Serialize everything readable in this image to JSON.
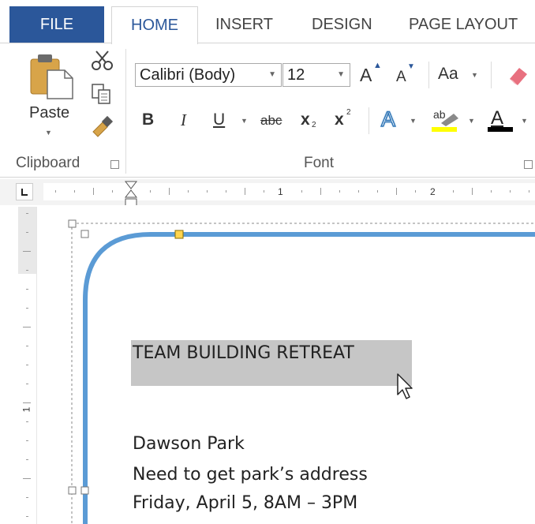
{
  "tabs": {
    "file": "FILE",
    "home": "HOME",
    "insert": "INSERT",
    "design": "DESIGN",
    "page_layout": "PAGE LAYOUT"
  },
  "clipboard": {
    "paste_label": "Paste",
    "group_label": "Clipboard"
  },
  "font": {
    "font_name": "Calibri (Body)",
    "font_size": "12",
    "change_case_label": "Aa",
    "group_label": "Font",
    "bold_label": "B",
    "italic_label": "I",
    "underline_label": "U",
    "strikethrough_label": "abc",
    "subscript_label": "x",
    "subscript_sub": "2",
    "superscript_label": "x",
    "superscript_sup": "2",
    "grow_font_label": "A",
    "shrink_font_label": "A",
    "text_effects_label": "A",
    "highlight_label": "ab",
    "font_color_label": "A"
  },
  "ruler": {
    "numbers": [
      "1",
      "2"
    ]
  },
  "document": {
    "title": "TEAM BUILDING RETREAT",
    "lines": [
      "Dawson Park",
      "Need to get park’s address",
      "Friday, April 5, 8AM – 3PM"
    ]
  },
  "vertical_ruler": {
    "number": "1"
  },
  "colors": {
    "file_tab_bg": "#2b579a",
    "accent": "#2b579a",
    "shape_outline": "#5b9bd5",
    "highlight": "#ffff00",
    "font_color_bar": "#000000",
    "selection_bg": "#c6c6c6"
  },
  "icons": [
    "cut-icon",
    "copy-icon",
    "format-painter-icon",
    "paste-icon",
    "clear-formatting-icon",
    "mouse-pointer-icon"
  ]
}
